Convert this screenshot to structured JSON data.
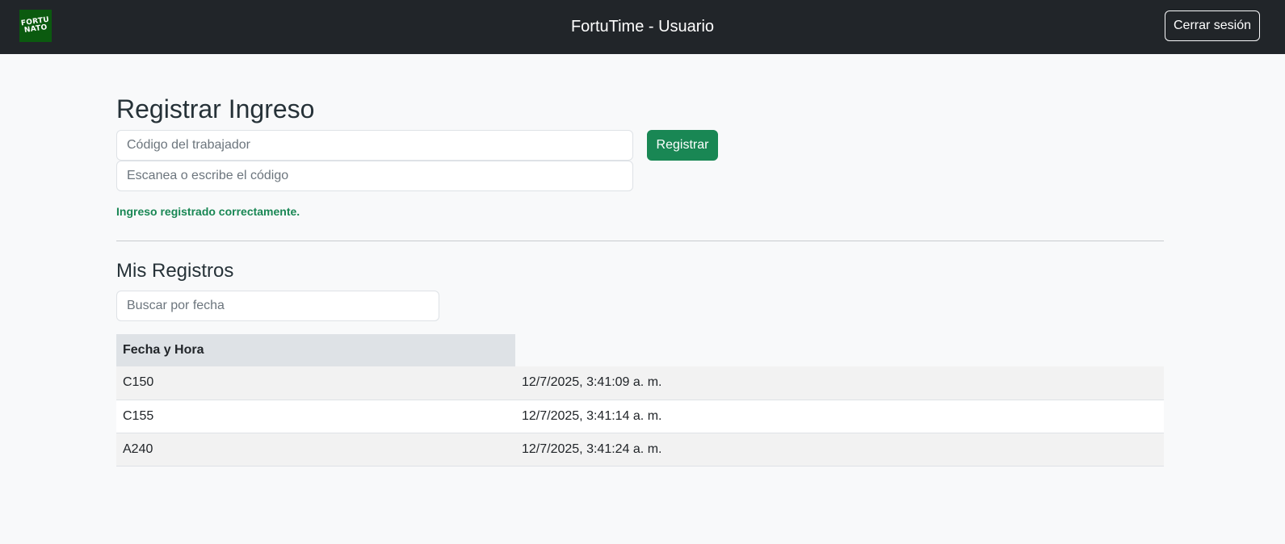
{
  "navbar": {
    "logo_line1": "FORTU",
    "logo_line2": "NATO",
    "title": "FortuTime - Usuario",
    "logout_label": "Cerrar sesión"
  },
  "register": {
    "heading": "Registrar Ingreso",
    "code_placeholder": "Código del trabajador",
    "scan_placeholder": "Escanea o escribe el código",
    "button_label": "Registrar",
    "success_message": "Ingreso registrado correctamente."
  },
  "records": {
    "heading": "Mis Registros",
    "search_placeholder": "Buscar por fecha",
    "columns": [
      "Fecha y Hora",
      ""
    ],
    "rows": [
      {
        "code": "C150",
        "datetime": "12/7/2025, 3:41:09 a. m."
      },
      {
        "code": "C155",
        "datetime": "12/7/2025, 3:41:14 a. m."
      },
      {
        "code": "A240",
        "datetime": "12/7/2025, 3:41:24 a. m."
      }
    ]
  },
  "colors": {
    "navbar": "#212529",
    "success": "#198754",
    "logo_bg": "#0b5a0f"
  }
}
